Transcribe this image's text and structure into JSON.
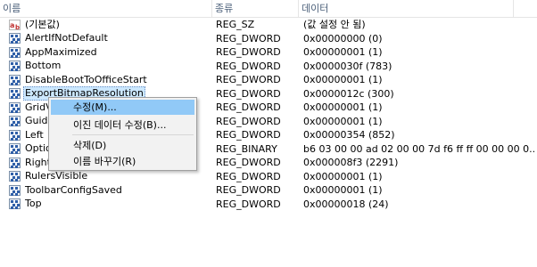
{
  "columns": {
    "name": "이름",
    "type": "종류",
    "data": "데이터"
  },
  "rows": [
    {
      "icon": "string",
      "name": "(기본값)",
      "type": "REG_SZ",
      "data": "(값 설정 안 됨)"
    },
    {
      "icon": "binary",
      "name": "AlertIfNotDefault",
      "type": "REG_DWORD",
      "data": "0x00000000 (0)"
    },
    {
      "icon": "binary",
      "name": "AppMaximized",
      "type": "REG_DWORD",
      "data": "0x00000001 (1)"
    },
    {
      "icon": "binary",
      "name": "Bottom",
      "type": "REG_DWORD",
      "data": "0x0000030f (783)"
    },
    {
      "icon": "binary",
      "name": "DisableBootToOfficeStart",
      "type": "REG_DWORD",
      "data": "0x00000001 (1)"
    },
    {
      "icon": "binary",
      "name": "ExportBitmapResolution",
      "type": "REG_DWORD",
      "data": "0x0000012c (300)"
    },
    {
      "icon": "binary",
      "name": "GridVi",
      "type": "REG_DWORD",
      "data": "0x00000001 (1)"
    },
    {
      "icon": "binary",
      "name": "Guides",
      "type": "REG_DWORD",
      "data": "0x00000001 (1)"
    },
    {
      "icon": "binary",
      "name": "Left",
      "type": "REG_DWORD",
      "data": "0x00000354 (852)"
    },
    {
      "icon": "binary",
      "name": "Option",
      "type": "REG_BINARY",
      "data": "b6 03 00 00 ad 02 00 00 7d f6 ff ff 00 00 00 0..."
    },
    {
      "icon": "binary",
      "name": "Right",
      "type": "REG_DWORD",
      "data": "0x000008f3 (2291)"
    },
    {
      "icon": "binary",
      "name": "RulersVisible",
      "type": "REG_DWORD",
      "data": "0x00000001 (1)"
    },
    {
      "icon": "binary",
      "name": "ToolbarConfigSaved",
      "type": "REG_DWORD",
      "data": "0x00000001 (1)"
    },
    {
      "icon": "binary",
      "name": "Top",
      "type": "REG_DWORD",
      "data": "0x00000018 (24)"
    }
  ],
  "selected_row": "ExportBitmapResolution",
  "context_menu": {
    "items": [
      {
        "label": "수정(M)...",
        "highlighted": true
      },
      {
        "label": "이진 데이터 수정(B)..."
      },
      {
        "separator": true
      },
      {
        "label": "삭제(D)"
      },
      {
        "label": "이름 바꾸기(R)"
      }
    ]
  },
  "colors": {
    "selection": "#cce8ff",
    "menu_highlight": "#91c9f7",
    "header_text": "#4c607a"
  }
}
